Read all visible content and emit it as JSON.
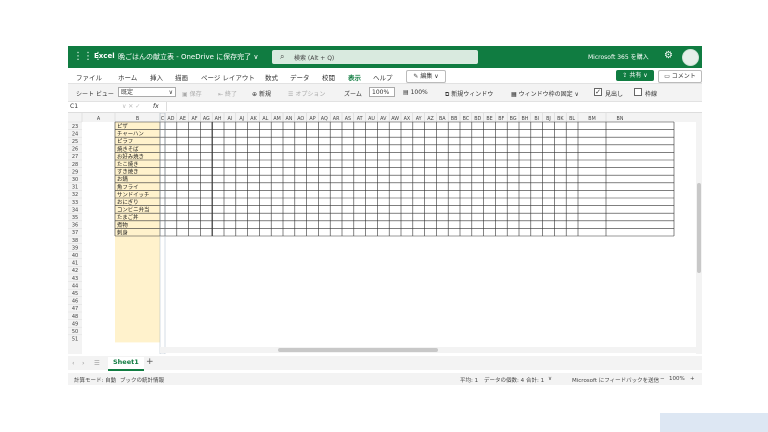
{
  "titlebar": {
    "app_name": "Excel",
    "doc_title": "晩ごはんの献立表 - OneDrive に保存完了 ∨",
    "search_placeholder": "検索 (Alt + Q)",
    "ms365_label": "Microsoft 365 を購入"
  },
  "menu": {
    "items": [
      "ファイル",
      "ホーム",
      "挿入",
      "描画",
      "ページ レイアウト",
      "数式",
      "データ",
      "校閲",
      "表示",
      "ヘルプ"
    ],
    "active": "表示",
    "edit_label": "編集 ∨",
    "share_label": "共有 ∨",
    "comment_label": "コメント"
  },
  "ribbon": {
    "sheet_view_label": "シート ビュー",
    "sheet_view_value": "既定",
    "save": "保存",
    "end": "終了",
    "new": "新規",
    "options": "オプション",
    "zoom_label": "ズーム",
    "zoom_value": "100%",
    "zoom100": "100%",
    "new_window": "新規ウィンドウ",
    "freeze_panes": "ウィンドウ枠の固定 ∨",
    "headings": "見出し",
    "gridlines": "枠線",
    "headings_checked": true,
    "gridlines_checked": false
  },
  "formula_bar": {
    "name_box": "C1",
    "cancel_enter": "∨ ✕ ✓",
    "fx": "fx",
    "value": ""
  },
  "grid": {
    "columns": [
      "A",
      "B",
      "C",
      "AD",
      "AE",
      "AF",
      "AG",
      "AH",
      "AI",
      "AJ",
      "AK",
      "AL",
      "AM",
      "AN",
      "AO",
      "AP",
      "AQ",
      "AR",
      "AS",
      "AT",
      "AU",
      "AV",
      "AW",
      "AX",
      "AY",
      "AZ",
      "BA",
      "BB",
      "BC",
      "BD",
      "BE",
      "BF",
      "BG",
      "BH",
      "BI",
      "BJ",
      "BK",
      "BL",
      "BM",
      "BN"
    ],
    "rows": [
      {
        "num": "23",
        "b": "ピザ"
      },
      {
        "num": "24",
        "b": "チャーハン"
      },
      {
        "num": "25",
        "b": "ピラフ"
      },
      {
        "num": "26",
        "b": "焼きそば"
      },
      {
        "num": "27",
        "b": "お好み焼き"
      },
      {
        "num": "28",
        "b": "たこ焼き"
      },
      {
        "num": "29",
        "b": "すき焼き"
      },
      {
        "num": "30",
        "b": "お鍋"
      },
      {
        "num": "31",
        "b": "魚フライ"
      },
      {
        "num": "32",
        "b": "サンドイッチ"
      },
      {
        "num": "33",
        "b": "おにぎり"
      },
      {
        "num": "34",
        "b": "コンビニ弁当"
      },
      {
        "num": "35",
        "b": "たまご丼"
      },
      {
        "num": "36",
        "b": "煮物"
      },
      {
        "num": "37",
        "b": "刺身"
      },
      {
        "num": "38",
        "b": ""
      },
      {
        "num": "39",
        "b": ""
      },
      {
        "num": "40",
        "b": ""
      },
      {
        "num": "41",
        "b": ""
      },
      {
        "num": "42",
        "b": ""
      },
      {
        "num": "43",
        "b": ""
      },
      {
        "num": "44",
        "b": ""
      },
      {
        "num": "45",
        "b": ""
      },
      {
        "num": "46",
        "b": ""
      },
      {
        "num": "47",
        "b": ""
      },
      {
        "num": "48",
        "b": ""
      },
      {
        "num": "49",
        "b": ""
      },
      {
        "num": "50",
        "b": ""
      },
      {
        "num": "51",
        "b": ""
      }
    ],
    "filled_rows": 15
  },
  "sheets": {
    "tabs": [
      "Sheet1"
    ],
    "add": "+"
  },
  "status": {
    "calc_mode": "計算モード: 自動",
    "stats": "ブックの統計情報",
    "average": "平均: 1",
    "count": "データの個数: 4",
    "sum": "合計: 1",
    "feedback": "Microsoft にフィードバックを送信",
    "zoom": "100%"
  },
  "colors": {
    "brand": "#107c41",
    "highlight": "#fff2cc"
  }
}
